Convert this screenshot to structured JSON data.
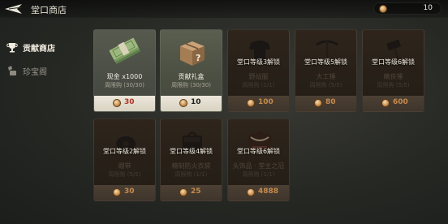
{
  "header": {
    "title": "堂口商店",
    "currency_value": "10"
  },
  "sidebar": {
    "items": [
      {
        "label": "贡献商店"
      },
      {
        "label": "珍宝阁"
      }
    ]
  },
  "items": [
    {
      "name": "现金 x1000",
      "limit": "周限购 (30/30)",
      "price": "30"
    },
    {
      "name": "贡献礼盒",
      "limit": "周限购 (30/30)",
      "price": "10"
    },
    {
      "unlock": "堂口等级3解锁",
      "name": "野战服",
      "limit": "周限购 (1/1)",
      "price": "100"
    },
    {
      "unlock": "堂口等级5解锁",
      "name": "大工锤",
      "limit": "周限购 (5/5)",
      "price": "80"
    },
    {
      "unlock": "堂口等级6解锁",
      "name": "精良锤",
      "limit": "周限购 (5/5)",
      "price": "600"
    },
    {
      "unlock": "堂口等级2解锁",
      "name": "绷带",
      "limit": "周限购 (5/5)",
      "price": "30"
    },
    {
      "unlock": "堂口等级4解锁",
      "name": "精制防火衣袋",
      "limit": "周限购 (1/1)",
      "price": "25"
    },
    {
      "unlock": "堂口等级6解锁",
      "name": "头饰品 · 堂主之冠",
      "limit": "周限购 (1/1)",
      "price": "4888"
    }
  ],
  "colors": {
    "price_affordable_bg": "#ece7da",
    "price_red": "#b0322a",
    "price_locked": "#c58a4c"
  },
  "icons": {
    "back": "back-arrow-icon",
    "coin": "coin-icon",
    "shop": "trophy-icon",
    "treasure": "treasure-icon"
  }
}
